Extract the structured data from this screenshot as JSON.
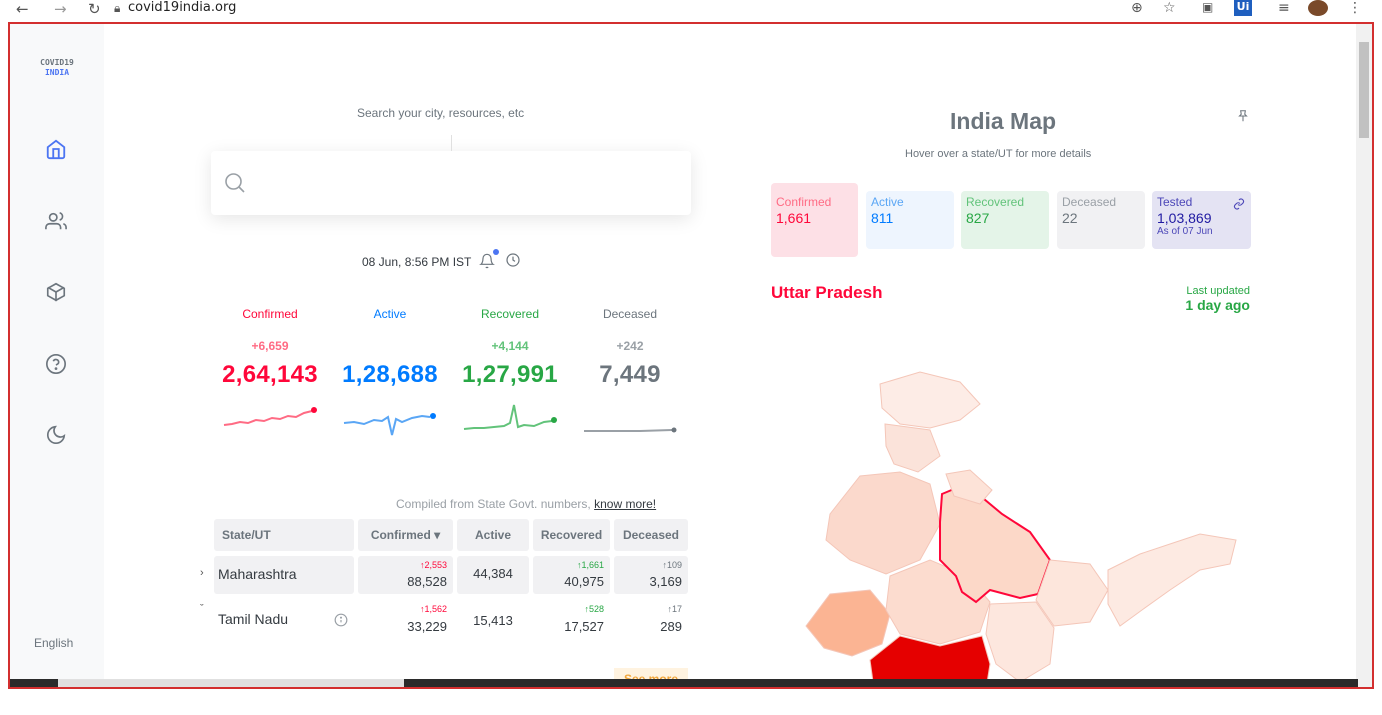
{
  "browser": {
    "url": "covid19india.org"
  },
  "sidebar": {
    "logo_line1": "COVID19",
    "logo_line2": "INDIA",
    "items": [
      {
        "name": "home-icon"
      },
      {
        "name": "users-icon"
      },
      {
        "name": "box-icon"
      },
      {
        "name": "help-icon"
      },
      {
        "name": "moon-icon"
      }
    ],
    "language": "English"
  },
  "search": {
    "caption": "Search your city, resources, etc",
    "placeholder": ""
  },
  "timestamp": "08 Jun, 8:56 PM IST",
  "stats": [
    {
      "label": "Confirmed",
      "delta": "+6,659",
      "value": "2,64,143",
      "color": "#ff073a"
    },
    {
      "label": "Active",
      "delta": "",
      "value": "1,28,688",
      "color": "#007bff"
    },
    {
      "label": "Recovered",
      "delta": "+4,144",
      "value": "1,27,991",
      "color": "#28a745"
    },
    {
      "label": "Deceased",
      "delta": "+242",
      "value": "7,449",
      "color": "#6c757d"
    }
  ],
  "compiled": {
    "text": "Compiled from State Govt. numbers,",
    "link": "know more!"
  },
  "table": {
    "headers": [
      "State/UT",
      "Confirmed ▾",
      "Active",
      "Recovered",
      "Deceased"
    ],
    "rows": [
      {
        "state": "Maharashtra",
        "expander": "›",
        "confirmed_delta": "↑2,553",
        "confirmed": "88,528",
        "active": "44,384",
        "recovered_delta": "↑1,661",
        "recovered": "40,975",
        "deceased_delta": "↑109",
        "deceased": "3,169"
      },
      {
        "state": "Tamil Nadu",
        "expander": "ˇ",
        "confirmed_delta": "↑1,562",
        "confirmed": "33,229",
        "active": "15,413",
        "recovered_delta": "↑528",
        "recovered": "17,527",
        "deceased_delta": "↑17",
        "deceased": "289"
      }
    ],
    "see_more": "See more"
  },
  "map": {
    "title": "India Map",
    "hint": "Hover over a state/UT for more details",
    "cards": [
      {
        "label": "Confirmed",
        "value": "1,661",
        "sub": "",
        "bg": "#fde0e6",
        "fg": "#ff073a"
      },
      {
        "label": "Active",
        "value": "811",
        "sub": "",
        "bg": "#eef5fe",
        "fg": "#007bff"
      },
      {
        "label": "Recovered",
        "value": "827",
        "sub": "",
        "bg": "#e4f4e8",
        "fg": "#28a745"
      },
      {
        "label": "Deceased",
        "value": "22",
        "sub": "",
        "bg": "#f1f1f3",
        "fg": "#6c757d"
      },
      {
        "label": "Tested",
        "value": "1,03,869",
        "sub": "As of 07 Jun",
        "bg": "#e4e3f3",
        "fg": "#201aa2"
      }
    ],
    "region": "Uttar Pradesh",
    "last_updated_label": "Last updated",
    "last_updated_value": "1 day ago"
  }
}
